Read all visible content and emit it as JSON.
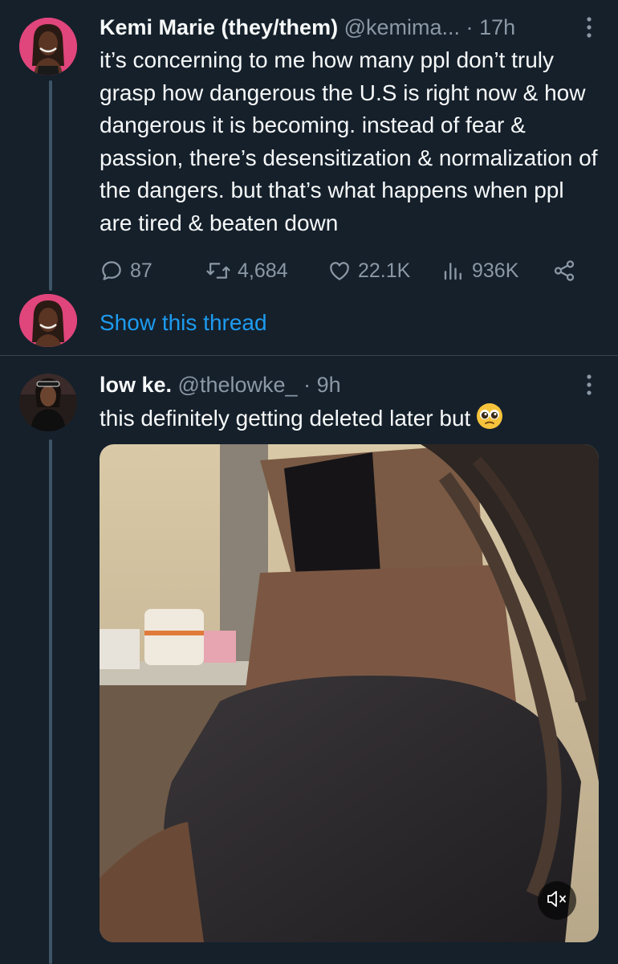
{
  "tweets": [
    {
      "name": "Kemi Marie (they/them)",
      "handle": "@kemima...",
      "separator": "·",
      "time": "17h",
      "text": "it’s concerning to me how many ppl don’t truly grasp how dangerous the U.S is right now & how dangerous it is becoming. instead of fear & passion, there’s desensitization & normalization of the dangers. but that’s what happens when ppl are tired & beaten down",
      "replies": "87",
      "retweets": "4,684",
      "likes": "22.1K",
      "views": "936K",
      "show_thread": "Show this thread"
    },
    {
      "name": "low ke.",
      "handle": "@thelowke_",
      "separator": "·",
      "time": "9h",
      "text": "this definitely getting deleted later but",
      "emoji": "pleading-face-emoji"
    }
  ],
  "colors": {
    "background": "#15202b",
    "text": "#f7f9f9",
    "secondary": "#8b98a5",
    "link": "#1d9bf0",
    "avatar_pink": "#e0457b"
  },
  "icons": [
    "more-icon",
    "reply-icon",
    "retweet-icon",
    "like-icon",
    "views-icon",
    "share-icon",
    "mute-icon"
  ]
}
